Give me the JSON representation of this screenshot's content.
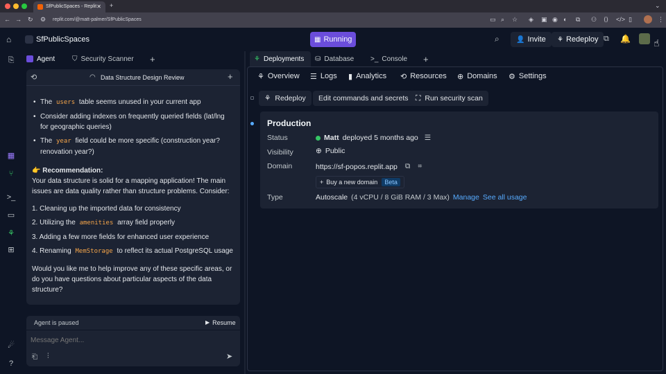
{
  "browser": {
    "tab_title": "SfPublicSpaces - Replit",
    "url": "replit.com/@matt-palmer/SfPublicSpaces"
  },
  "topbar": {
    "project_name": "SfPublicSpaces",
    "run_status": "Running",
    "invite_label": "Invite",
    "redeploy_label": "Redeploy"
  },
  "agent_tabs": [
    {
      "label": "Agent"
    },
    {
      "label": "Security Scanner"
    }
  ],
  "chat": {
    "title": "Data Structure Design Review",
    "bullets": [
      {
        "pre": "The",
        "code": "users",
        "post": "table seems unused in your current app"
      },
      {
        "pre": "Consider adding indexes on frequently queried fields (lat/lng for geographic queries)",
        "code": "",
        "post": ""
      },
      {
        "pre": "The",
        "code": "year",
        "post": "field could be more specific (construction year? renovation year?)"
      }
    ],
    "recommendation_heading": "👉 Recommendation:",
    "recommendation_body": "Your data structure is solid for a mapping application! The main issues are data quality rather than structure problems. Consider:",
    "numbered": [
      {
        "pre": "1. Cleaning up the imported data for consistency",
        "code": "",
        "post": ""
      },
      {
        "pre": "2. Utilizing the",
        "code": "amenities",
        "post": "array field properly"
      },
      {
        "pre": "3. Adding a few more fields for enhanced user experience",
        "code": "",
        "post": ""
      },
      {
        "pre": "4. Renaming",
        "code": "MemStorage",
        "post": "to reflect its actual PostgreSQL usage"
      }
    ],
    "closing": "Would you like me to help improve any of these specific areas, or do you have questions about particular aspects of the data structure?",
    "paused_label": "Agent is paused",
    "resume_label": "Resume",
    "composer_placeholder": "Message Agent..."
  },
  "right_tabs": [
    {
      "label": "Deployments"
    },
    {
      "label": "Database"
    },
    {
      "label": "Console"
    }
  ],
  "subnav": [
    {
      "label": "Overview"
    },
    {
      "label": "Logs"
    },
    {
      "label": "Analytics"
    },
    {
      "label": "Resources"
    },
    {
      "label": "Domains"
    },
    {
      "label": "Settings"
    }
  ],
  "actions": {
    "redeploy": "Redeploy",
    "edit": "Edit commands and secrets",
    "scan": "Run security scan"
  },
  "production": {
    "heading": "Production",
    "status_label": "Status",
    "status_user": "Matt",
    "status_text": "deployed 5 months ago",
    "visibility_label": "Visibility",
    "visibility_value": "Public",
    "domain_label": "Domain",
    "domain_value": "https://sf-popos.replit.app",
    "buy_domain": "Buy a new domain",
    "beta": "Beta",
    "type_label": "Type",
    "type_value": "Autoscale",
    "type_detail": "(4 vCPU / 8 GiB RAM / 3 Max)",
    "manage": "Manage",
    "see_usage": "See all usage"
  },
  "colors": {
    "running": "#6b4ddb",
    "status_green": "#36c565",
    "link": "#57abff",
    "code": "#f5a54a"
  }
}
